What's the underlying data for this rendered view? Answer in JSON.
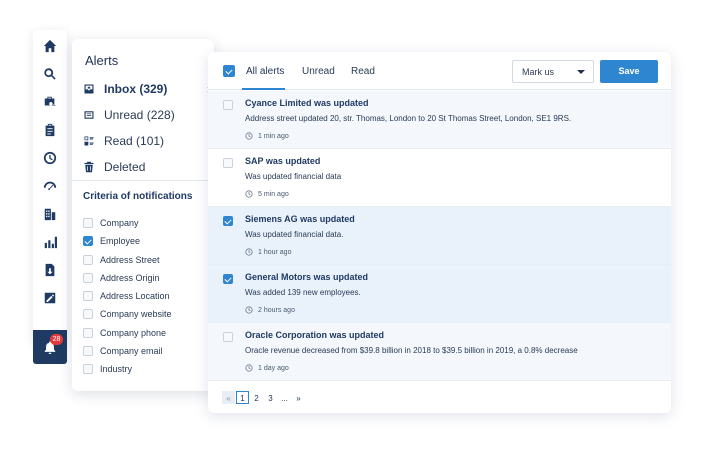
{
  "rail": {
    "items": [
      {
        "icon": "home-icon"
      },
      {
        "icon": "search-icon"
      },
      {
        "icon": "briefcase-search-icon"
      },
      {
        "icon": "clipboard-icon"
      },
      {
        "icon": "clock-icon"
      },
      {
        "icon": "gauge-icon"
      },
      {
        "icon": "building-icon"
      },
      {
        "icon": "bar-chart-icon"
      },
      {
        "icon": "document-download-icon"
      },
      {
        "icon": "edit-document-icon"
      }
    ],
    "bell": {
      "icon": "bell-icon",
      "badge": "28"
    }
  },
  "alerts": {
    "title": "Alerts",
    "folders": [
      {
        "label": "Inbox (329)",
        "icon": "inbox-icon",
        "active": true
      },
      {
        "label": "Unread (228)",
        "icon": "unread-icon",
        "active": false
      },
      {
        "label": "Read (101)",
        "icon": "read-icon",
        "active": false
      },
      {
        "label": "Deleted",
        "icon": "trash-icon",
        "active": false
      }
    ],
    "criteria_title": "Criteria of notifications",
    "criteria": [
      {
        "label": "Company",
        "checked": false
      },
      {
        "label": "Employee",
        "checked": true
      },
      {
        "label": "Address Street",
        "checked": false
      },
      {
        "label": "Address Origin",
        "checked": false
      },
      {
        "label": "Address Location",
        "checked": false
      },
      {
        "label": "Company website",
        "checked": false
      },
      {
        "label": "Company phone",
        "checked": false
      },
      {
        "label": "Company email",
        "checked": false
      },
      {
        "label": "Industry",
        "checked": false
      }
    ]
  },
  "main": {
    "tabs": [
      {
        "label": "All alerts",
        "active": true
      },
      {
        "label": "Unread",
        "active": false
      },
      {
        "label": "Read",
        "active": false
      }
    ],
    "mark_select": "Mark us",
    "save_label": "Save",
    "rows": [
      {
        "title": "Cyance Limited was updated",
        "desc": "Address street updated 20, str. Thomas, London to 20 St Thomas Street, London, SE1 9RS.",
        "time": "1 min ago",
        "checked": false
      },
      {
        "title": "SAP was updated",
        "desc": "Was updated financial data",
        "time": "5 min ago",
        "checked": false
      },
      {
        "title": "Siemens AG was updated",
        "desc": "Was updated financial data.",
        "time": "1 hour ago",
        "checked": true
      },
      {
        "title": "General Motors was updated",
        "desc": "Was added 139 new employees.",
        "time": "2 hours ago",
        "checked": true
      },
      {
        "title": "Oracle Corporation was updated",
        "desc": "Oracle revenue decreased from $39.8 billion in 2018 to $39.5 billion in 2019, a 0.8% decrease",
        "time": "1 day ago",
        "checked": false
      }
    ],
    "pager": {
      "prev": "«",
      "pages": [
        "1",
        "2",
        "3",
        "..."
      ],
      "next": "»",
      "current": "1"
    }
  },
  "colors": {
    "accent": "#2e86d1",
    "navy": "#1f3a63",
    "badge": "#e23b3b"
  }
}
